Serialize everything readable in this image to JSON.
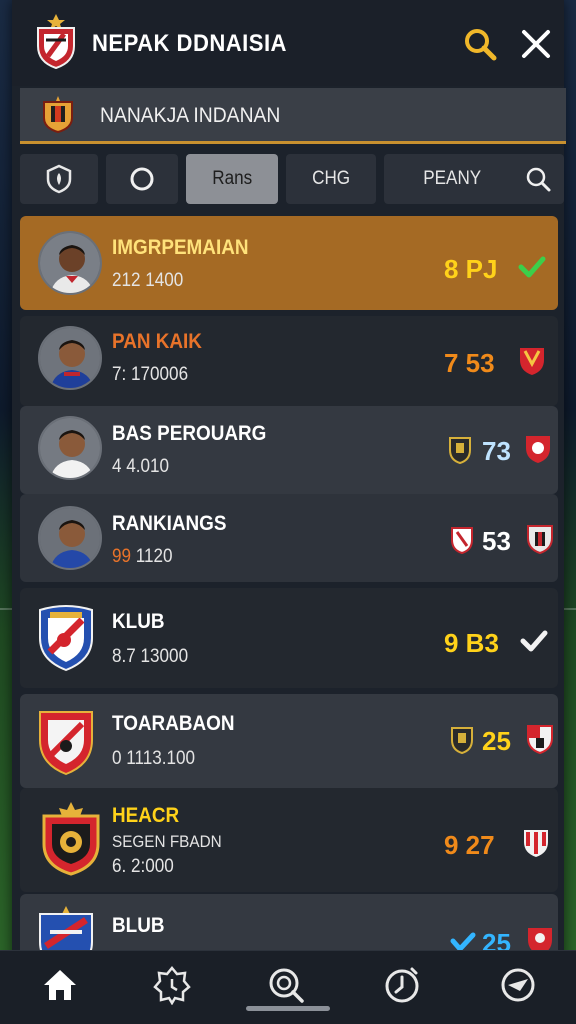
{
  "header": {
    "title": "NEPAK DDNAISIA",
    "search_icon": "search-icon",
    "close_icon": "close-icon",
    "accent": "#c8902f"
  },
  "subbar": {
    "title": "NANAKJA INDANAN"
  },
  "tabs": [
    {
      "icon": "shield-icon",
      "label": ""
    },
    {
      "icon": "circle-icon",
      "label": ""
    },
    {
      "label": "Rans",
      "active": true
    },
    {
      "label": "CHG"
    },
    {
      "label": "PEANY",
      "icon": "search-icon"
    }
  ],
  "list": [
    {
      "name": "IMGRPEMAIAN",
      "sub": "212 1400",
      "score": "8 PJ",
      "score_color": "#ffd21a",
      "status": "check-icon",
      "highlight": true
    },
    {
      "name": "PAN KAIK",
      "sub": "7: 170006",
      "score": "7 53",
      "score_color": "#f08a1a",
      "status": "shield-badge-icon"
    },
    {
      "name": "BAS PEROUARG",
      "sub": "4 4.010",
      "score": "73",
      "score_color": "#bfe3ff",
      "status": "shield-badge-icon"
    },
    {
      "name": "RANKIANGS",
      "sub_prefix": "99",
      "sub": "1120",
      "score": "53",
      "score_color": "#ffffff",
      "status": "shield-badge-icon"
    },
    {
      "name": "KLUB",
      "sub": "8.7 13000",
      "score": "9 B3",
      "score_color": "#ffd21a",
      "status": "check-icon"
    },
    {
      "name": "TOARABAON",
      "sub": "0 1113.100",
      "score": "25",
      "score_color": "#ffd21a",
      "status": "shield-badge-icon"
    },
    {
      "name": "HEACR",
      "name2": "SEGEN FBADN",
      "sub": "6. 2:000",
      "score": "9 27",
      "score_color": "#f08a1a",
      "status": "shield-badge-icon"
    },
    {
      "name": "BLUB",
      "sub": "",
      "score": "25",
      "score_color": "#33b5ff",
      "status": "shield-badge-icon"
    }
  ],
  "bottom_nav": [
    {
      "icon": "home-icon",
      "active": true
    },
    {
      "icon": "badge-icon"
    },
    {
      "icon": "search-icon"
    },
    {
      "icon": "timer-icon"
    },
    {
      "icon": "compass-icon"
    }
  ]
}
